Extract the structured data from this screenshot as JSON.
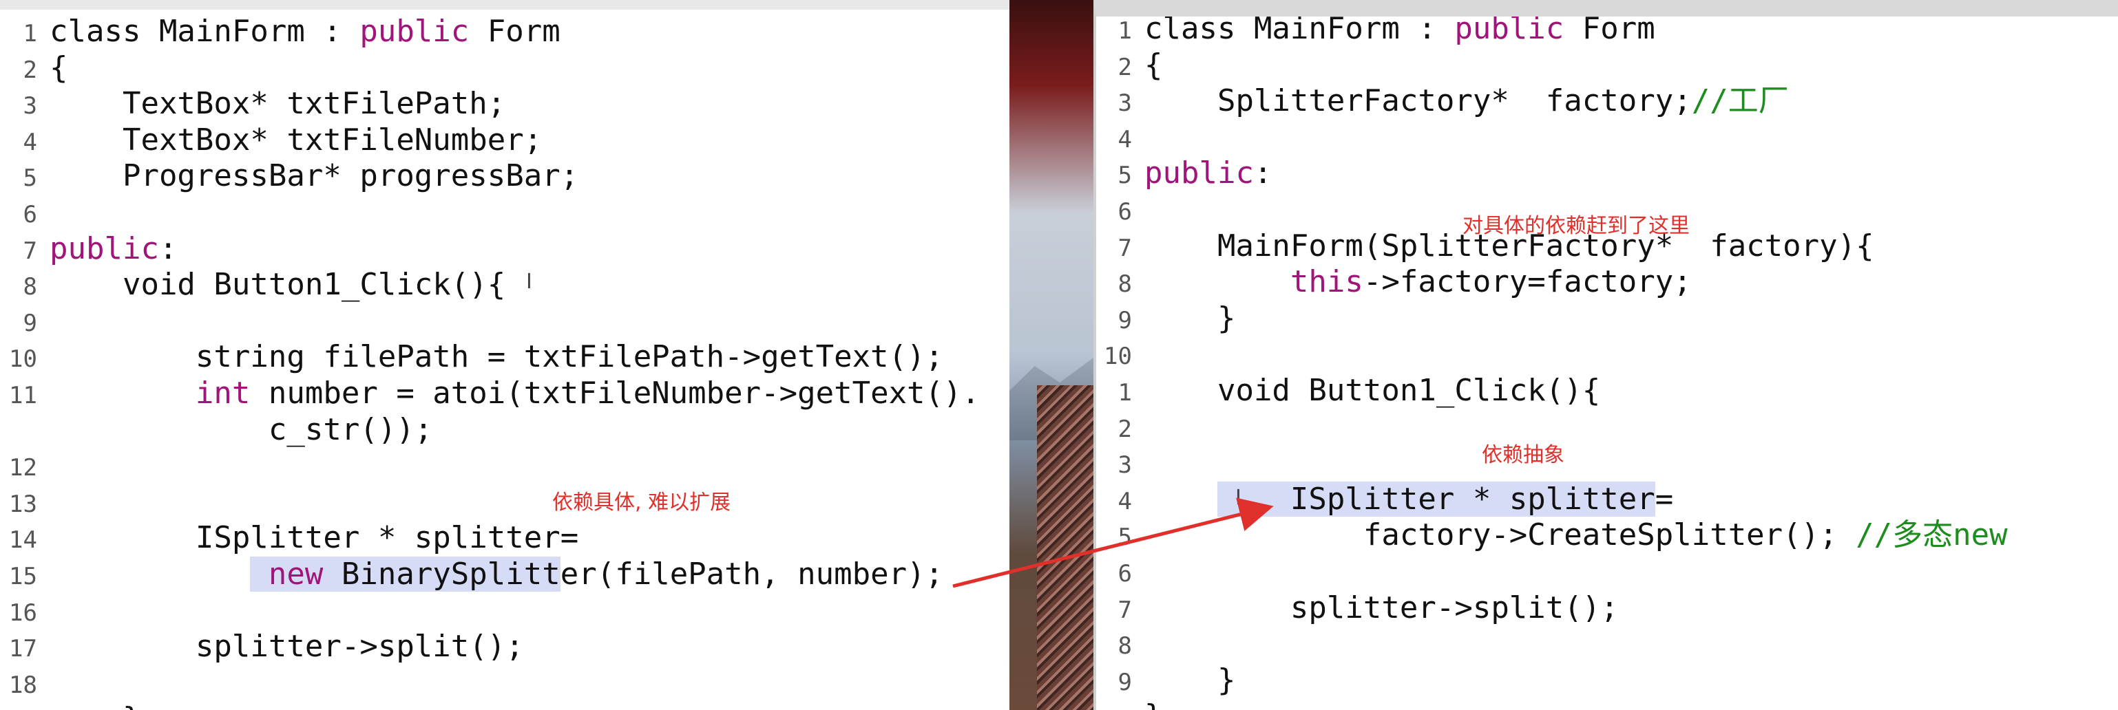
{
  "left": {
    "lines": [
      {
        "n": "1",
        "code": [
          {
            "t": "class MainForm : "
          },
          {
            "t": "public",
            "k": "kw"
          },
          {
            "t": " Form"
          }
        ]
      },
      {
        "n": "2",
        "code": [
          {
            "t": "{"
          }
        ]
      },
      {
        "n": "3",
        "code": [
          {
            "t": "    TextBox* txtFilePath;"
          }
        ]
      },
      {
        "n": "4",
        "code": [
          {
            "t": "    TextBox* txtFileNumber;"
          }
        ]
      },
      {
        "n": "5",
        "code": [
          {
            "t": "    ProgressBar* progressBar;"
          }
        ]
      },
      {
        "n": "6",
        "code": [
          {
            "t": ""
          }
        ]
      },
      {
        "n": "7",
        "code": [
          {
            "t": "public",
            "k": "kw"
          },
          {
            "t": ":"
          }
        ]
      },
      {
        "n": "8",
        "code": [
          {
            "t": "    void Button1_Click(){"
          }
        ]
      },
      {
        "n": "9",
        "code": [
          {
            "t": ""
          }
        ]
      },
      {
        "n": "10",
        "code": [
          {
            "t": "        string filePath = txtFilePath->getText();"
          }
        ]
      },
      {
        "n": "11",
        "code": [
          {
            "t": "        "
          },
          {
            "t": "int",
            "k": "kw"
          },
          {
            "t": " number = atoi(txtFileNumber->getText()."
          }
        ]
      },
      {
        "n": "",
        "code": [
          {
            "t": "            c_str());"
          }
        ]
      },
      {
        "n": "12",
        "code": [
          {
            "t": ""
          }
        ]
      },
      {
        "n": "13",
        "code": [
          {
            "t": ""
          }
        ]
      },
      {
        "n": "14",
        "code": [
          {
            "t": "        ISplitter * splitter="
          }
        ]
      },
      {
        "n": "15",
        "code": [
          {
            "t": "           "
          },
          {
            "t": " new",
            "k": "kw hl"
          },
          {
            "t": " BinarySplitt",
            "k": "hl"
          },
          {
            "t": "er(filePath, number);"
          }
        ]
      },
      {
        "n": "16",
        "code": [
          {
            "t": ""
          }
        ]
      },
      {
        "n": "17",
        "code": [
          {
            "t": "        splitter->split();"
          }
        ]
      },
      {
        "n": "18",
        "code": [
          {
            "t": ""
          }
        ]
      },
      {
        "n": "",
        "code": [
          {
            "t": "    }"
          }
        ]
      }
    ],
    "note": "依赖具体, 难以扩展"
  },
  "right": {
    "lines": [
      {
        "n": "1",
        "code": [
          {
            "t": "class MainForm : "
          },
          {
            "t": "public",
            "k": "kw"
          },
          {
            "t": " Form"
          }
        ]
      },
      {
        "n": "2",
        "code": [
          {
            "t": "{"
          }
        ]
      },
      {
        "n": "3",
        "code": [
          {
            "t": "    SplitterFactory*  factory;"
          },
          {
            "t": "//工厂",
            "k": "cm"
          }
        ]
      },
      {
        "n": "4",
        "code": [
          {
            "t": ""
          }
        ]
      },
      {
        "n": "5",
        "code": [
          {
            "t": "public",
            "k": "kw"
          },
          {
            "t": ":"
          }
        ]
      },
      {
        "n": "6",
        "code": [
          {
            "t": ""
          }
        ]
      },
      {
        "n": "7",
        "code": [
          {
            "t": "    MainForm(SplitterFactory*  factory){"
          }
        ]
      },
      {
        "n": "8",
        "code": [
          {
            "t": "        "
          },
          {
            "t": "this",
            "k": "kw"
          },
          {
            "t": "->factory=factory;"
          }
        ]
      },
      {
        "n": "9",
        "code": [
          {
            "t": "    }"
          }
        ]
      },
      {
        "n": "10",
        "code": [
          {
            "t": ""
          }
        ]
      },
      {
        "n": "1",
        "code": [
          {
            "t": "    void Button1_Click(){"
          }
        ]
      },
      {
        "n": "2",
        "code": [
          {
            "t": ""
          }
        ]
      },
      {
        "n": "3",
        "code": [
          {
            "t": ""
          }
        ]
      },
      {
        "n": "4",
        "code": [
          {
            "t": "    "
          },
          {
            "t": "    ISplitter * splitter",
            "k": "hl"
          },
          {
            "t": "="
          }
        ]
      },
      {
        "n": "5",
        "code": [
          {
            "t": "            factory->CreateSplitter(); "
          },
          {
            "t": "//多态new",
            "k": "cm"
          }
        ]
      },
      {
        "n": "6",
        "code": [
          {
            "t": ""
          }
        ]
      },
      {
        "n": "7",
        "code": [
          {
            "t": "        splitter->split();"
          }
        ]
      },
      {
        "n": "8",
        "code": [
          {
            "t": ""
          }
        ]
      },
      {
        "n": "9",
        "code": [
          {
            "t": "    }"
          }
        ]
      },
      {
        "n": "",
        "code": [
          {
            "t": "}"
          }
        ]
      }
    ],
    "note_top": "对具体的依赖赶到了这里",
    "note_mid": "依赖抽象"
  },
  "cursor_glyph": "I",
  "colors": {
    "keyword": "#a0157a",
    "comment": "#1e8c1e",
    "highlight": "#d6dcf5",
    "annotation": "#e0302b"
  }
}
